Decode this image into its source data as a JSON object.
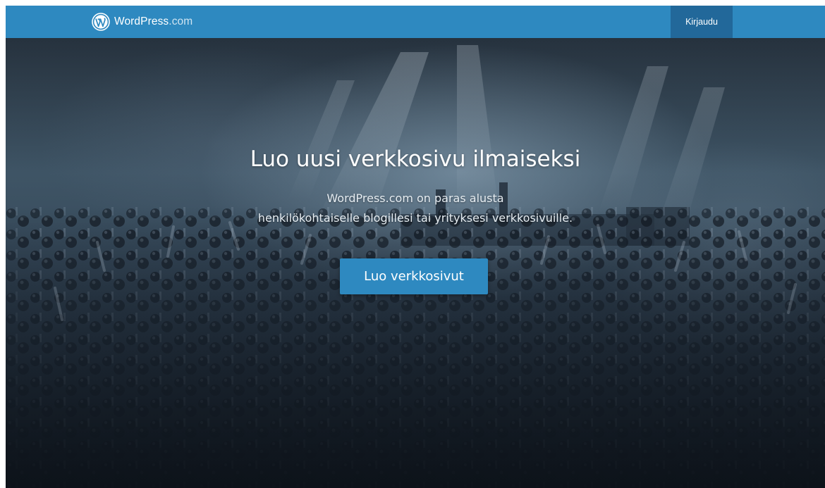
{
  "masterbar": {
    "brand": "WordPress",
    "brand_suffix": ".com",
    "login_label": "Kirjaudu"
  },
  "hero": {
    "headline": "Luo uusi verkkosivu ilmaiseksi",
    "subline_1": "WordPress.com on paras alusta",
    "subline_2": "henkilökohtaiselle blogillesi tai yrityksesi verkkosivuille.",
    "cta_label": "Luo verkkosivut"
  },
  "icons": {
    "logo": "wordpress-logo-icon"
  },
  "colors": {
    "masterbar": "#2e89c0",
    "login_button": "#22689a",
    "cta_button": "#2e89c0",
    "text": "#ffffff"
  }
}
